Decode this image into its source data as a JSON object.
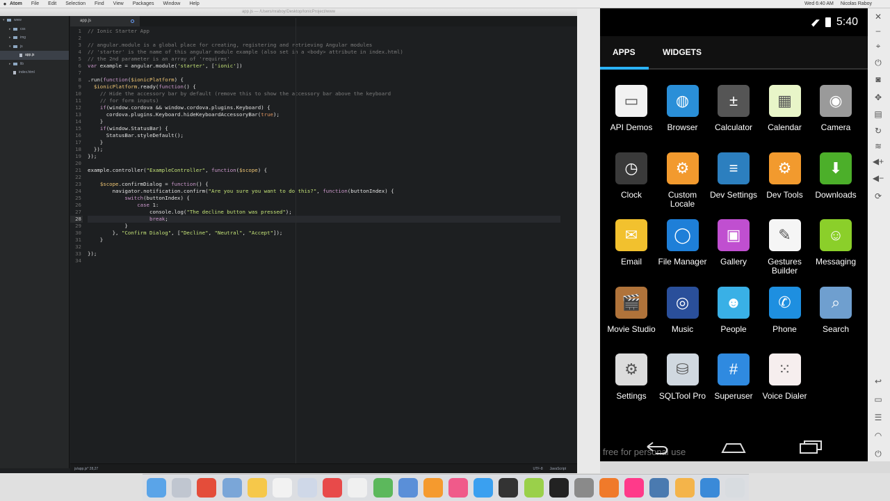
{
  "menubar": {
    "apple": "",
    "app": "Atom",
    "items": [
      "File",
      "Edit",
      "Selection",
      "Find",
      "View",
      "Packages",
      "Window",
      "Help"
    ],
    "right": [
      "Wed 6:40 AM",
      "Nicolas Raboy"
    ]
  },
  "atom": {
    "title": "app.js — /Users/nraboy/Desktop/IonicProject/www",
    "tree": [
      {
        "label": "www",
        "type": "folder",
        "open": true,
        "depth": 0
      },
      {
        "label": "css",
        "type": "folder",
        "open": false,
        "depth": 1
      },
      {
        "label": "img",
        "type": "folder",
        "open": false,
        "depth": 1
      },
      {
        "label": "js",
        "type": "folder",
        "open": true,
        "depth": 1
      },
      {
        "label": "app.js",
        "type": "file",
        "depth": 2,
        "selected": true
      },
      {
        "label": "lib",
        "type": "folder",
        "open": false,
        "depth": 1
      },
      {
        "label": "index.html",
        "type": "file",
        "depth": 1
      }
    ],
    "tab_label": "app.js",
    "status": {
      "path": "js/app.js* 28,27",
      "encoding": "UTF-8",
      "grammar": "JavaScript"
    },
    "current_line": 28,
    "code": [
      "// Ionic Starter App",
      "",
      "// angular.module is a global place for creating, registering and retrieving Angular modules",
      "// 'starter' is the name of this angular module example (also set in a <body> attribute in index.html)",
      "// the 2nd parameter is an array of 'requires'",
      "var example = angular.module('starter', ['ionic'])",
      "",
      ".run(function($ionicPlatform) {",
      "  $ionicPlatform.ready(function() {",
      "    // Hide the accessory bar by default (remove this to show the accessory bar above the keyboard",
      "    // for form inputs)",
      "    if(window.cordova && window.cordova.plugins.Keyboard) {",
      "      cordova.plugins.Keyboard.hideKeyboardAccessoryBar(true);",
      "    }",
      "    if(window.StatusBar) {",
      "      StatusBar.styleDefault();",
      "    }",
      "  });",
      "});",
      "",
      "example.controller(\"ExampleController\", function($scope) {",
      "",
      "    $scope.confirmDialog = function() {",
      "        navigator.notification.confirm(\"Are you sure you want to do this?\", function(buttonIndex) {",
      "            switch(buttonIndex) {",
      "                case 1:",
      "                    console.log(\"The decline button was pressed\");",
      "                    break;",
      "            }",
      "        }, \"Confirm Dialog\", [\"Decline\", \"Neutral\", \"Accept\"]);",
      "    }",
      "",
      "});",
      ""
    ]
  },
  "android": {
    "time": "5:40",
    "tabs": [
      "APPS",
      "WIDGETS"
    ],
    "watermark": "free for personal use",
    "apps": [
      {
        "label": "API Demos",
        "icon": "folder-icon",
        "color": "#f2f2f2",
        "glyph": "▭"
      },
      {
        "label": "Browser",
        "icon": "globe-icon",
        "color": "#2a8fd8",
        "glyph": "◍"
      },
      {
        "label": "Calculator",
        "icon": "calculator-icon",
        "color": "#555555",
        "glyph": "±"
      },
      {
        "label": "Calendar",
        "icon": "calendar-icon",
        "color": "#e8f5c8",
        "glyph": "▦"
      },
      {
        "label": "Camera",
        "icon": "camera-icon",
        "color": "#9a9a9a",
        "glyph": "◉"
      },
      {
        "label": "Clock",
        "icon": "clock-icon",
        "color": "#3a3a3a",
        "glyph": "◷"
      },
      {
        "label": "Custom Locale",
        "icon": "gear-icon",
        "color": "#f29a2e",
        "glyph": "⚙"
      },
      {
        "label": "Dev Settings",
        "icon": "sliders-icon",
        "color": "#2c7fbf",
        "glyph": "≡"
      },
      {
        "label": "Dev Tools",
        "icon": "gear-icon",
        "color": "#f29a2e",
        "glyph": "⚙"
      },
      {
        "label": "Downloads",
        "icon": "download-icon",
        "color": "#4caf2a",
        "glyph": "⬇"
      },
      {
        "label": "Email",
        "icon": "envelope-icon",
        "color": "#f2c12e",
        "glyph": "✉"
      },
      {
        "label": "File Manager",
        "icon": "file-manager-icon",
        "color": "#1e7fd8",
        "glyph": "◯"
      },
      {
        "label": "Gallery",
        "icon": "gallery-icon",
        "color": "#c04fd0",
        "glyph": "▣"
      },
      {
        "label": "Gestures Builder",
        "icon": "gestures-icon",
        "color": "#f5f5f5",
        "glyph": "✎"
      },
      {
        "label": "Messaging",
        "icon": "messaging-icon",
        "color": "#8bcf2a",
        "glyph": "☺"
      },
      {
        "label": "Movie Studio",
        "icon": "clapper-icon",
        "color": "#b0733a",
        "glyph": "🎬"
      },
      {
        "label": "Music",
        "icon": "music-icon",
        "color": "#2a4f9a",
        "glyph": "◎"
      },
      {
        "label": "People",
        "icon": "people-icon",
        "color": "#39b0e6",
        "glyph": "☻"
      },
      {
        "label": "Phone",
        "icon": "phone-icon",
        "color": "#1e8fe0",
        "glyph": "✆"
      },
      {
        "label": "Search",
        "icon": "search-icon",
        "color": "#6f9fcf",
        "glyph": "⌕"
      },
      {
        "label": "Settings",
        "icon": "gear-icon",
        "color": "#dcdcdc",
        "glyph": "⚙"
      },
      {
        "label": "SQLTool Pro",
        "icon": "database-icon",
        "color": "#d0d8e0",
        "glyph": "⛁"
      },
      {
        "label": "Superuser",
        "icon": "hash-icon",
        "color": "#2f8ae0",
        "glyph": "#"
      },
      {
        "label": "Voice Dialer",
        "icon": "voice-dialer-icon",
        "color": "#f6eeee",
        "glyph": "⁙"
      }
    ]
  },
  "dock": {
    "icons": [
      "finder-icon",
      "launchpad-icon",
      "chrome-icon",
      "preview-icon",
      "notes-icon",
      "calendar-icon",
      "mail-icon",
      "photo-booth-icon",
      "textedit-icon",
      "numbers-icon",
      "keynote-icon",
      "pages-icon",
      "itunes-icon",
      "app-store-icon",
      "unity-icon",
      "android-icon",
      "terminal-icon",
      "preferences-icon",
      "firefox-icon",
      "flickr-icon",
      "network-icon",
      "home-icon",
      "safari-icon",
      "trash-icon"
    ],
    "colors": [
      "#5aa4e8",
      "#c0c6d0",
      "#e44d3a",
      "#7aa6d8",
      "#f6c84a",
      "#f2f2f2",
      "#cfd8e8",
      "#e84a4a",
      "#f0f0f0",
      "#5cb85c",
      "#5a8fd8",
      "#f59a2e",
      "#f05a8a",
      "#3aa0f0",
      "#333333",
      "#9ad04a",
      "#222222",
      "#8a8a8a",
      "#f07a2a",
      "#ff3a8a",
      "#4a7ab0",
      "#f4b44a",
      "#3a8ad8",
      "#d8dce0"
    ]
  }
}
